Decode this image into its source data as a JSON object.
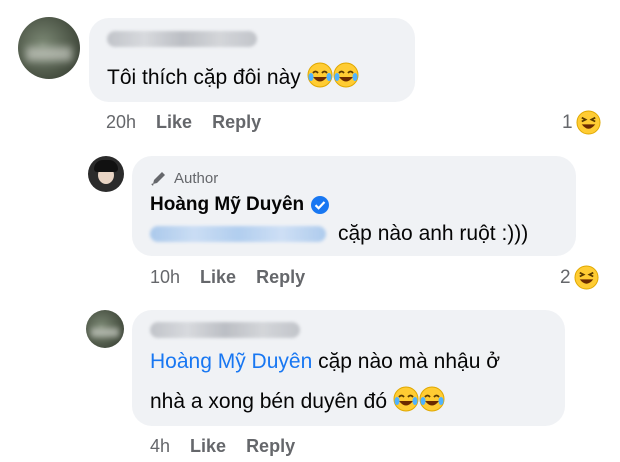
{
  "comment1": {
    "text": "Tôi thích cặp đôi này",
    "time": "20h",
    "like": "Like",
    "reply": "Reply",
    "reaction_count": "1"
  },
  "comment2": {
    "author_badge": "Author",
    "author_name": "Hoàng Mỹ Duyên",
    "text": "cặp nào anh ruột :)))",
    "time": "10h",
    "like": "Like",
    "reply": "Reply",
    "reaction_count": "2"
  },
  "comment3": {
    "mention": "Hoàng Mỹ Duyên",
    "text_line1": "cặp nào mà nhậu ở",
    "text_line2": "nhà a xong bén duyên đó",
    "time": "4h",
    "like": "Like",
    "reply": "Reply"
  },
  "colors": {
    "accent": "#1877f2",
    "bubble": "#f0f2f5",
    "meta": "#65676b"
  },
  "icons": [
    "laughing-emoji-icon",
    "tears-of-joy-emoji-icon",
    "pencil-icon",
    "verified-badge-icon"
  ]
}
